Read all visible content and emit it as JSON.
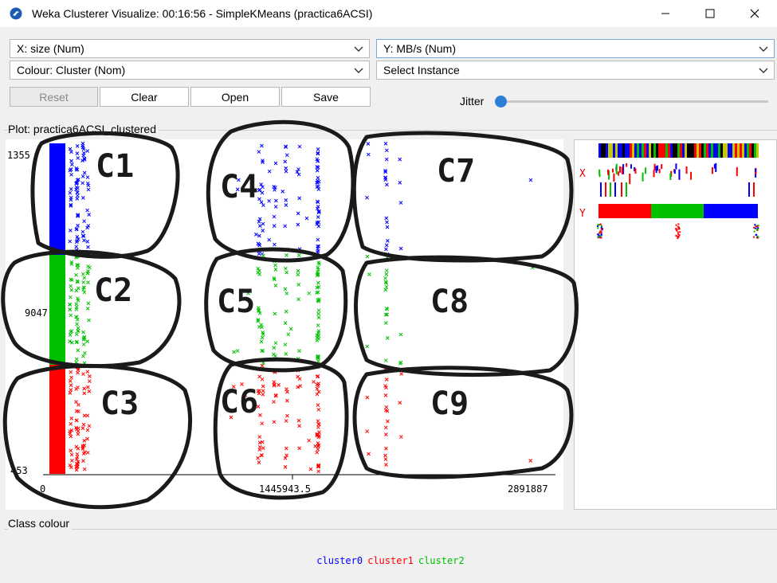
{
  "window": {
    "title": "Weka Clusterer Visualize: 00:16:56 - SimpleKMeans (practica6ACSI)",
    "icons": [
      "weka-bird-icon",
      "minimize-icon",
      "maximize-icon",
      "close-icon"
    ]
  },
  "controls": {
    "x_axis": "X: size (Num)",
    "y_axis": "Y: MB/s (Num)",
    "colour": "Colour: Cluster (Nom)",
    "instance": "Select Instance",
    "buttons": {
      "reset": "Reset",
      "clear": "Clear",
      "open": "Open",
      "save": "Save"
    },
    "jitter_label": "Jitter",
    "jitter_value": 0
  },
  "plot": {
    "group_title": "Plot: practica6ACSI_clustered",
    "y_ticks": [
      "1355",
      "9047",
      "453"
    ],
    "x_ticks": [
      "0",
      "1445943.5",
      "2891887"
    ],
    "side_labels": {
      "x": "X",
      "y": "Y"
    }
  },
  "annotations": [
    "C1",
    "C2",
    "C3",
    "C4",
    "C5",
    "C6",
    "C7",
    "C8",
    "C9"
  ],
  "class_colour": {
    "group_title": "Class colour",
    "items": [
      {
        "label": "cluster0",
        "color": "#0000ff"
      },
      {
        "label": "cluster1",
        "color": "#ff0000"
      },
      {
        "label": "cluster2",
        "color": "#00c000"
      }
    ]
  }
}
